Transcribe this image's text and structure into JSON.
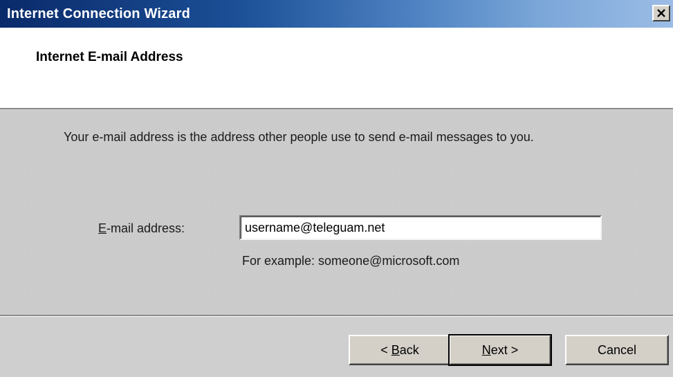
{
  "window": {
    "title": "Internet Connection Wizard"
  },
  "header": {
    "title": "Internet E-mail Address"
  },
  "content": {
    "description": "Your e-mail address is the address other people use to send e-mail messages to you.",
    "email_label_mnemonic": "E",
    "email_label_rest": "-mail address:",
    "email_value": "username@teleguam.net",
    "example_text": "For example: someone@microsoft.com"
  },
  "buttons": {
    "back_prefix": "< ",
    "back_mnemonic": "B",
    "back_rest": "ack",
    "next_mnemonic": "N",
    "next_rest": "ext >",
    "cancel_label": "Cancel"
  },
  "colors": {
    "titlebar_start": "#0a2a6a",
    "titlebar_end": "#9cbde6",
    "dialog_face": "#d4d0c8"
  },
  "icons": {
    "close": "close-icon"
  }
}
